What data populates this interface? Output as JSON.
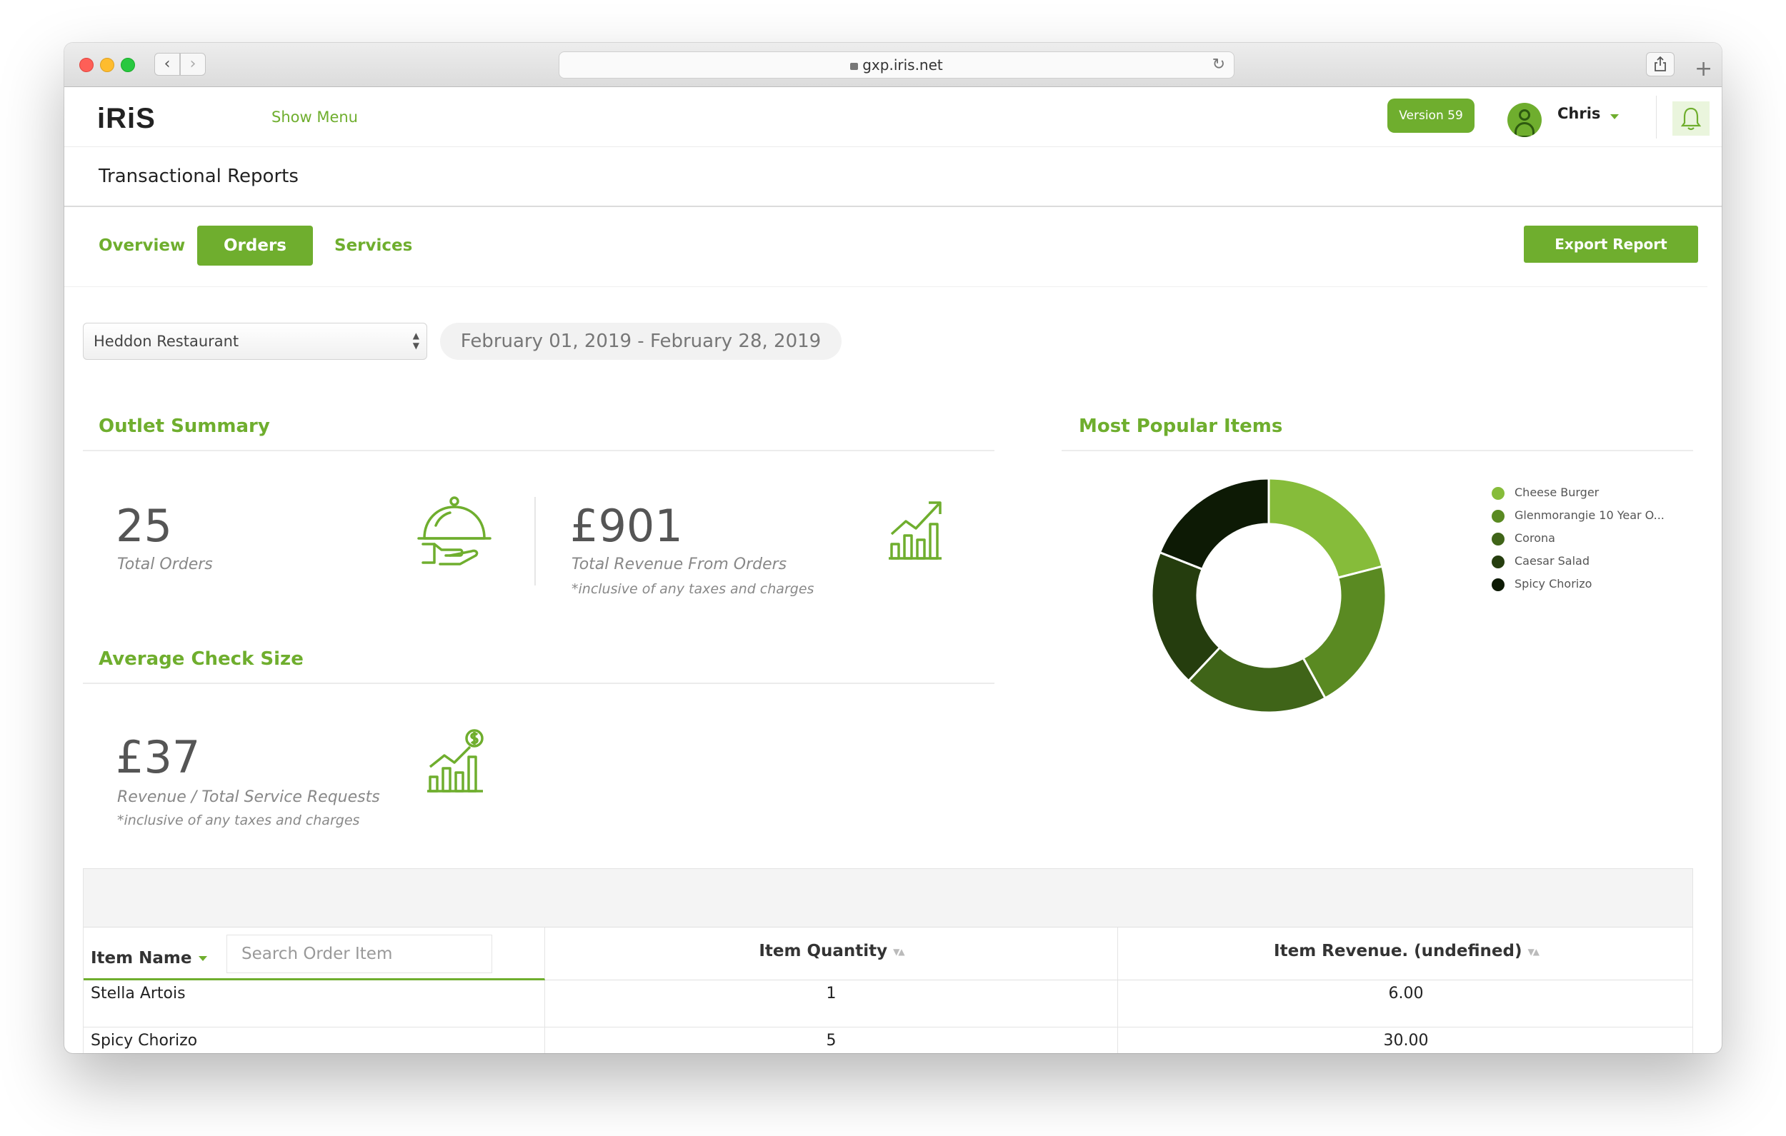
{
  "browser": {
    "url": "gxp.iris.net"
  },
  "header": {
    "logo": "iRiS",
    "show_menu": "Show Menu",
    "version": "Version 59",
    "user_name": "Chris"
  },
  "page": {
    "title": "Transactional Reports"
  },
  "tabs": [
    {
      "label": "Overview",
      "active": false
    },
    {
      "label": "Orders",
      "active": true
    },
    {
      "label": "Services",
      "active": false
    }
  ],
  "export_label": "Export Report",
  "filters": {
    "outlet": "Heddon Restaurant",
    "date_range": "February 01, 2019 - February 28, 2019"
  },
  "outlet_summary": {
    "title": "Outlet Summary",
    "total_orders": "25",
    "total_orders_label": "Total Orders",
    "total_revenue": "£901",
    "total_revenue_label": "Total Revenue From Orders",
    "total_revenue_note": "*inclusive of any taxes and charges"
  },
  "average_check": {
    "title": "Average Check Size",
    "value": "£37",
    "label": "Revenue / Total Service Requests",
    "note": "*inclusive of any taxes and charges"
  },
  "popular": {
    "title": "Most Popular Items"
  },
  "chart_data": {
    "type": "pie",
    "title": "Most Popular Items",
    "categories": [
      "Cheese Burger",
      "Glenmorangie 10 Year O...",
      "Corona",
      "Caesar Salad",
      "Spicy Chorizo"
    ],
    "values": [
      21,
      21,
      20,
      19,
      19
    ],
    "colors": [
      "#86bc3a",
      "#5a8a22",
      "#3f6418",
      "#253d0e",
      "#0d1a05"
    ],
    "legend": "right"
  },
  "table": {
    "col_item_name": "Item Name",
    "search_placeholder": "Search Order Item",
    "col_quantity": "Item Quantity",
    "col_revenue": "Item Revenue. (undefined)",
    "rows": [
      {
        "name": "Stella Artois",
        "quantity": "1",
        "revenue": "6.00"
      },
      {
        "name": "Spicy Chorizo",
        "quantity": "5",
        "revenue": "30.00"
      }
    ]
  },
  "colors": {
    "accent": "#6fae2e"
  }
}
